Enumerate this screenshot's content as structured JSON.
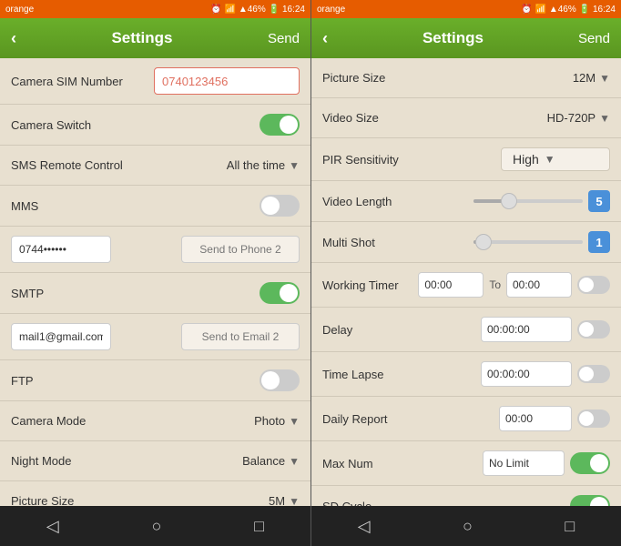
{
  "left": {
    "status": {
      "carrier": "orange",
      "time": "16:24",
      "battery": "46%",
      "icons": "⏰ 📶 📶 46% 🔋"
    },
    "header": {
      "back": "‹",
      "title": "Settings",
      "send": "Send"
    },
    "rows": [
      {
        "id": "camera-sim",
        "label": "Camera SIM Number",
        "type": "input",
        "value": "0740123456"
      },
      {
        "id": "camera-switch",
        "label": "Camera Switch",
        "type": "toggle",
        "state": "on"
      },
      {
        "id": "sms-remote",
        "label": "SMS Remote Control",
        "type": "select",
        "value": "All the time"
      },
      {
        "id": "mms",
        "label": "MMS",
        "type": "toggle",
        "state": "off"
      },
      {
        "id": "phone-inputs",
        "label": "",
        "type": "phone-row",
        "phone": "0744••••••",
        "send": "Send to Phone 2"
      },
      {
        "id": "smtp",
        "label": "SMTP",
        "type": "toggle",
        "state": "on"
      },
      {
        "id": "email-inputs",
        "label": "",
        "type": "email-row",
        "email": "mail1@gmail.com",
        "send": "Send to Email 2"
      },
      {
        "id": "ftp",
        "label": "FTP",
        "type": "toggle",
        "state": "off"
      },
      {
        "id": "camera-mode",
        "label": "Camera Mode",
        "type": "select",
        "value": "Photo"
      },
      {
        "id": "night-mode",
        "label": "Night Mode",
        "type": "select",
        "value": "Balance"
      },
      {
        "id": "picture-size",
        "label": "Picture Size",
        "type": "select",
        "value": "5M"
      }
    ],
    "nav": [
      "◁",
      "○",
      "□"
    ]
  },
  "right": {
    "status": {
      "carrier": "orange",
      "time": "16:24",
      "battery": "46%"
    },
    "header": {
      "back": "‹",
      "title": "Settings",
      "send": "Send"
    },
    "rows": [
      {
        "id": "picture-size",
        "label": "Picture Size",
        "type": "select",
        "value": "12M"
      },
      {
        "id": "video-size",
        "label": "Video Size",
        "type": "select",
        "value": "HD-720P"
      },
      {
        "id": "pir-sensitivity",
        "label": "PIR Sensitivity",
        "type": "select",
        "value": "High"
      },
      {
        "id": "video-length",
        "label": "Video Length",
        "type": "slider",
        "value": 5
      },
      {
        "id": "multi-shot",
        "label": "Multi Shot",
        "type": "slider",
        "value": 1
      },
      {
        "id": "working-timer",
        "label": "Working Timer",
        "type": "time-range",
        "from": "00:00",
        "to": "00:00"
      },
      {
        "id": "delay",
        "label": "Delay",
        "type": "time-input",
        "value": "00:00:00"
      },
      {
        "id": "time-lapse",
        "label": "Time Lapse",
        "type": "time-input",
        "value": "00:00:00"
      },
      {
        "id": "daily-report",
        "label": "Daily Report",
        "type": "time-input",
        "value": "00:00",
        "short": true
      },
      {
        "id": "max-num",
        "label": "Max Num",
        "type": "text-toggle",
        "value": "No Limit",
        "state": "on"
      },
      {
        "id": "sd-cycle",
        "label": "SD Cycle",
        "type": "toggle",
        "state": "on"
      }
    ],
    "nav": [
      "◁",
      "○",
      "□"
    ]
  }
}
